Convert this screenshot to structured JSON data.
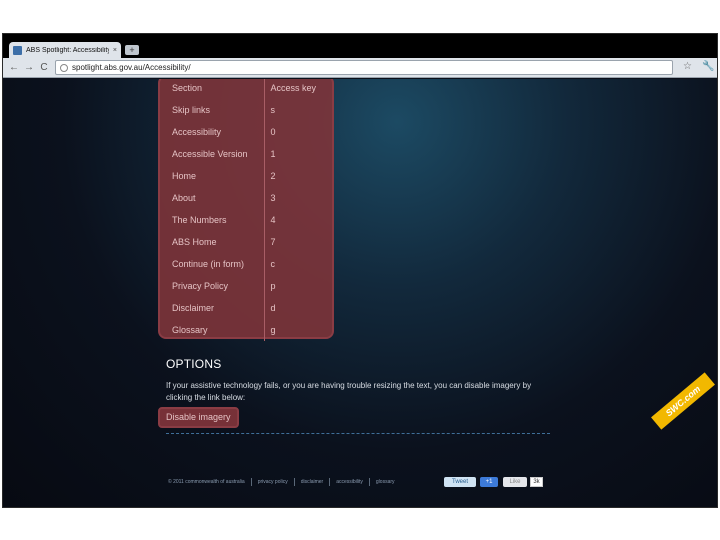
{
  "browser": {
    "tab_title": "ABS Spotlight: Accessibility",
    "tab_close": "×",
    "new_tab": "+",
    "url": "spotlight.abs.gov.au/Accessibility/",
    "nav": {
      "back": "←",
      "forward": "→",
      "reload": "C",
      "star": "☆",
      "wrench": "🔧"
    }
  },
  "access_keys": {
    "headers": {
      "section": "Section",
      "key": "Access key"
    },
    "rows": [
      {
        "section": "Skip links",
        "key": "s"
      },
      {
        "section": "Accessibility",
        "key": "0"
      },
      {
        "section": "Accessible Version",
        "key": "1"
      },
      {
        "section": "Home",
        "key": "2"
      },
      {
        "section": "About",
        "key": "3"
      },
      {
        "section": "The Numbers",
        "key": "4"
      },
      {
        "section": "ABS Home",
        "key": "7"
      },
      {
        "section": "Continue (in form)",
        "key": "c"
      },
      {
        "section": "Privacy Policy",
        "key": "p"
      },
      {
        "section": "Disclaimer",
        "key": "d"
      },
      {
        "section": "Glossary",
        "key": "g"
      }
    ]
  },
  "options": {
    "title": "OPTIONS",
    "text": "If your assistive technology fails, or you are having trouble resizing the text, you can disable imagery by clicking the link below:",
    "disable_link": "Disable imagery"
  },
  "footer": {
    "links": [
      "© 2011 commonwealth of australia",
      "privacy policy",
      "disclaimer",
      "accessibility",
      "glossary"
    ],
    "tweet": "Tweet",
    "plusone": "+1",
    "like": "Like",
    "like_count": "3k"
  },
  "watermark": "SWC.com",
  "colors": {
    "panel": "#7d343a",
    "background": "#0b111d",
    "accent": "#3f6f99"
  }
}
